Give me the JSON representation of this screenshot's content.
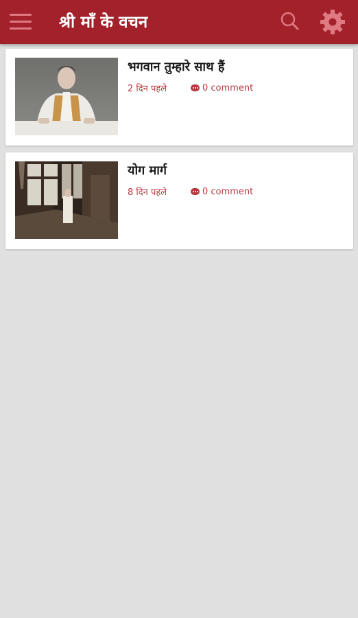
{
  "app": {
    "title": "श्री माँ के वचन",
    "accent_color": "#a3212b",
    "menu_icon": "menu-icon",
    "search_icon": "search-icon",
    "settings_icon": "gear-icon"
  },
  "posts": [
    {
      "title": "भगवान तुम्हारे साथ हैं",
      "date": "2 दिन पहले",
      "comments": "0 comment"
    },
    {
      "title": "योग मार्ग",
      "date": "8 दिन पहले",
      "comments": "0 comment"
    }
  ]
}
